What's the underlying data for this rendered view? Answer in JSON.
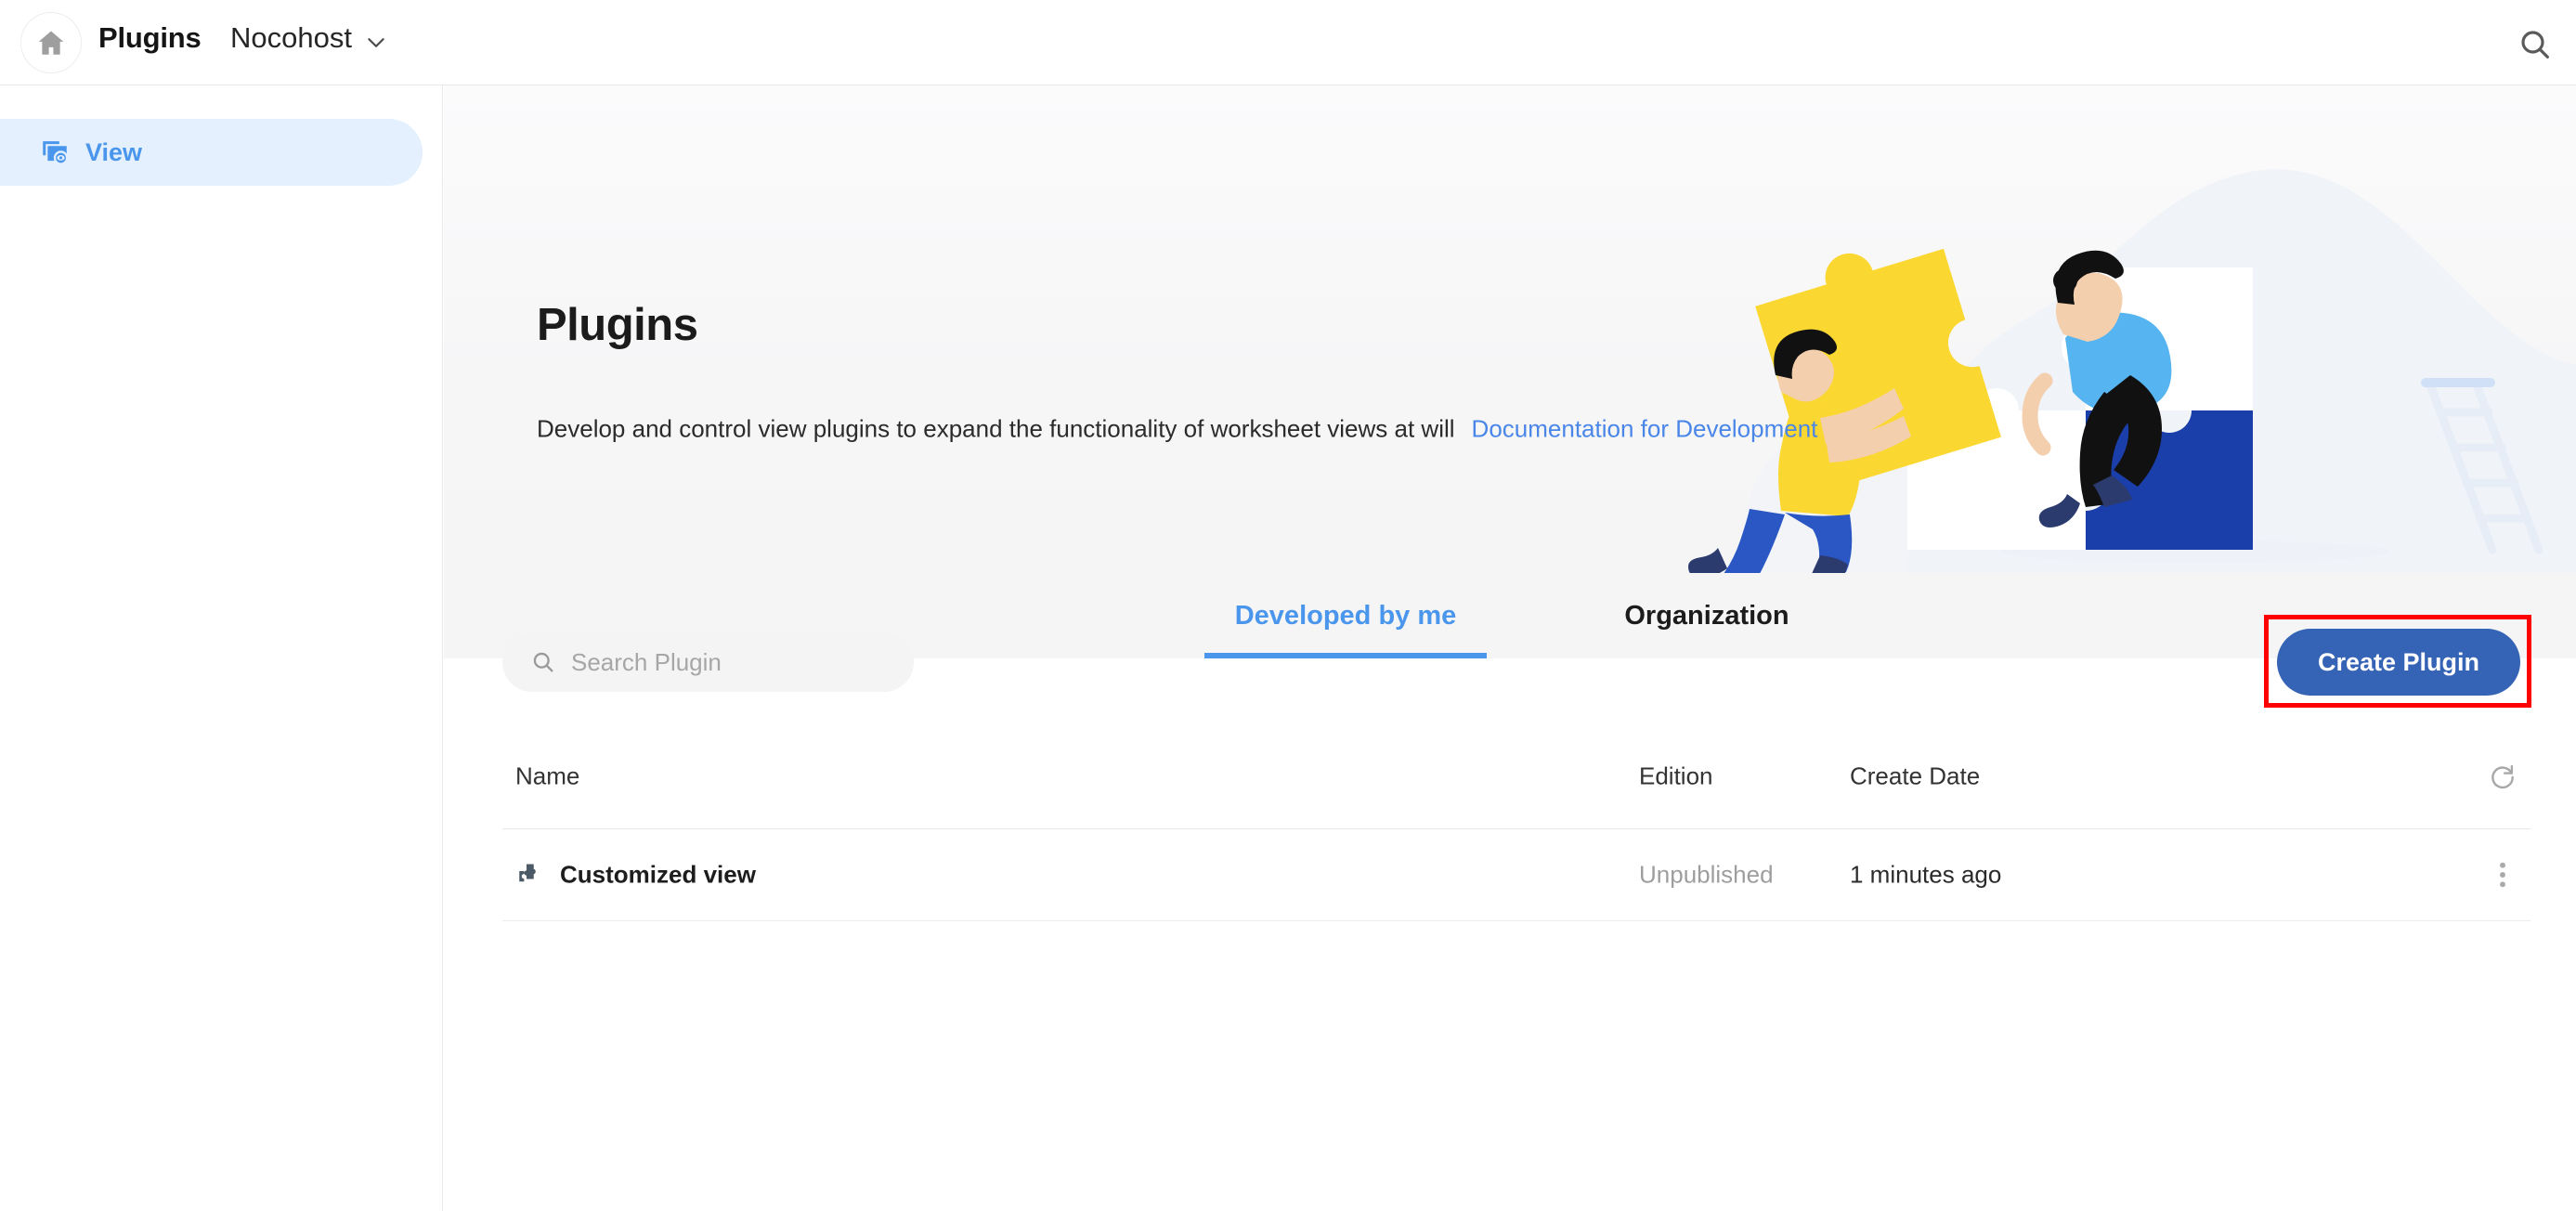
{
  "topbar": {
    "home_icon": "home-icon",
    "app_title": "Plugins",
    "org_name": "Nocohost",
    "org_caret_icon": "chevron-down-icon",
    "search_icon": "search-icon"
  },
  "sidebar": {
    "items": [
      {
        "label": "View",
        "icon": "view-window-icon",
        "active": true
      }
    ]
  },
  "hero": {
    "title": "Plugins",
    "subtitle": "Develop and control view plugins to expand the functionality of worksheet views at will",
    "link_label": "Documentation for Development",
    "illustration": "puzzle-teamwork-illustration"
  },
  "tabs": [
    {
      "label": "Developed by me",
      "active": true
    },
    {
      "label": "Organization",
      "active": false
    }
  ],
  "toolbar": {
    "search_placeholder": "Search Plugin",
    "search_value": "",
    "search_icon": "search-icon",
    "create_label": "Create Plugin"
  },
  "table": {
    "columns": [
      "Name",
      "Edition",
      "Create Date"
    ],
    "refresh_icon": "refresh-icon",
    "rows": [
      {
        "icon": "puzzle-piece-icon",
        "name": "Customized view",
        "edition": "Unpublished",
        "create_date": "1 minutes ago",
        "menu_icon": "more-vertical-icon"
      }
    ]
  },
  "colors": {
    "accent_blue": "#4a96ec",
    "link_blue": "#4a86e8",
    "button_blue": "#3563b5",
    "highlight_red": "#ff0000",
    "sidebar_active_bg": "#e4f0fd",
    "hero_bg": "#f5f5f6"
  }
}
